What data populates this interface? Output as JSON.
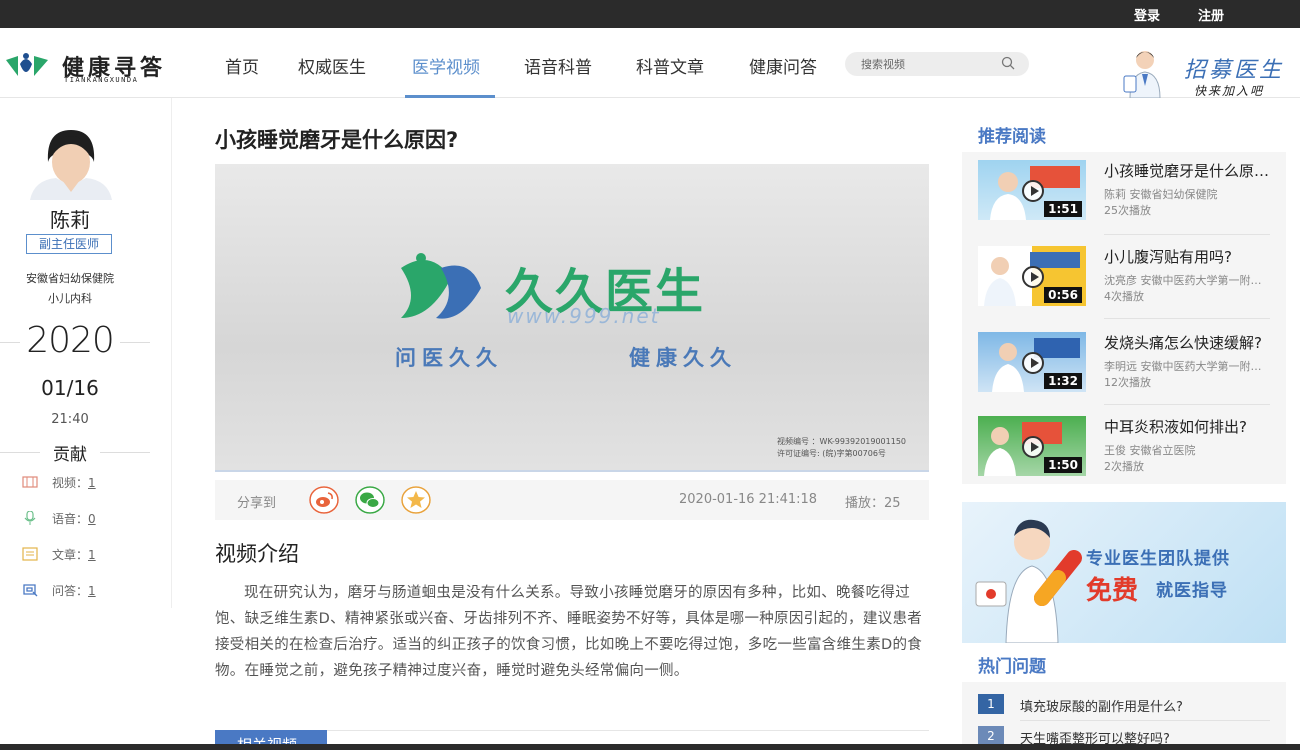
{
  "topbar": {
    "login": "登录",
    "register": "注册"
  },
  "header": {
    "logo_text": "健康寻答",
    "logo_sub": "TIANKANGXUNDA",
    "nav": [
      "首页",
      "权威医生",
      "医学视频",
      "语音科普",
      "科普文章",
      "健康问答"
    ],
    "active_nav": "医学视频",
    "search_placeholder": "搜索视频",
    "recruit_title": "招募医生",
    "recruit_sub": "快来加入吧"
  },
  "doctor": {
    "name": "陈莉",
    "title": "副主任医师",
    "hospital": "安徽省妇幼保健院",
    "department": "小儿内科",
    "year": "2020",
    "month_day": "01/16",
    "time": "21:40",
    "contrib_title": "贡献",
    "stats": [
      {
        "label": "视频：",
        "value": "1"
      },
      {
        "label": "语音：",
        "value": "0"
      },
      {
        "label": "文章：",
        "value": "1"
      },
      {
        "label": "问答：",
        "value": "1"
      }
    ]
  },
  "main": {
    "title": "小孩睡觉磨牙是什么原因?",
    "video": {
      "brand": "久久医生",
      "url": "www.999.net",
      "slogan_left": "问医久久",
      "slogan_right": "健康久久",
      "code_line": "视频编号    ：WK-99392019001150",
      "license_line": "许可证编号: (皖)字第00706号"
    },
    "share_label": "分享到",
    "datetime": "2020-01-16 21:41:18",
    "plays": "播放：25",
    "intro_title": "视频介绍",
    "intro_body": "现在研究认为，磨牙与肠道蛔虫是没有什么关系。导致小孩睡觉磨牙的原因有多种，比如、晚餐吃得过饱、缺乏维生素D、精神紧张或兴奋、牙齿排列不齐、睡眠姿势不好等，具体是哪一种原因引起的，建议患者接受相关的在检查后治疗。适当的纠正孩子的饮食习惯，比如晚上不要吃得过饱，多吃一些富含维生素D的食物。在睡觉之前，避免孩子精神过度兴奋，睡觉时避免头经常偏向一侧。",
    "related_tab": "相关视频"
  },
  "recommend": {
    "heading": "推荐阅读",
    "items": [
      {
        "title": "小孩睡觉磨牙是什么原因?",
        "author": "陈莉  安徽省妇幼保健院",
        "plays": "25次播放",
        "duration": "1:51"
      },
      {
        "title": "小儿腹泻贴有用吗?",
        "author": "沈亮彦  安徽中医药大学第一附属医院",
        "plays": "4次播放",
        "duration": "0:56"
      },
      {
        "title": "发烧头痛怎么快速缓解?",
        "author": "李明远  安徽中医药大学第一附属医院",
        "plays": "12次播放",
        "duration": "1:32"
      },
      {
        "title": "中耳炎积液如何排出?",
        "author": "王俊  安徽省立医院",
        "plays": "2次播放",
        "duration": "1:50"
      }
    ]
  },
  "banner": {
    "line1": "专业医生团队提供",
    "line2_free": "免费",
    "line2_rest": "就医指导"
  },
  "hot": {
    "heading": "热门问题",
    "items": [
      {
        "num": "1",
        "q": "填充玻尿酸的副作用是什么?"
      },
      {
        "num": "2",
        "q": "天生嘴歪整形可以整好吗?"
      }
    ]
  },
  "colors": {
    "accent": "#4a79c4",
    "nav_active": "#5c8fcc",
    "free_red": "#e23b2b"
  }
}
